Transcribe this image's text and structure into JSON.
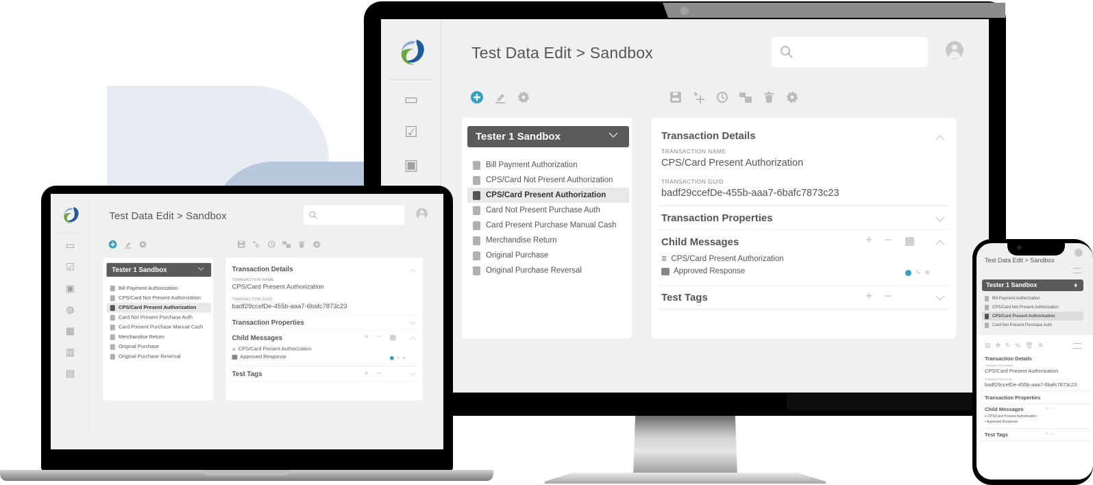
{
  "app": {
    "title": "Test Data Edit > Sandbox",
    "search": {
      "placeholder": ""
    },
    "accent_color": "#34a0c4",
    "sidebar": {
      "icons": [
        "windows-icon",
        "checklist-card-icon",
        "card-check-icon",
        "globe-sync-icon",
        "calendar-search-icon",
        "report-touch-icon",
        "document-search-icon"
      ]
    },
    "left_toolbar": [
      "add-icon",
      "edit-icon",
      "gear-icon"
    ],
    "right_toolbar": [
      "save-icon",
      "move-icon",
      "history-icon",
      "transfer-icon",
      "trash-icon",
      "gear-icon"
    ],
    "sandbox": {
      "selected": "Tester 1 Sandbox",
      "transactions": [
        {
          "label": "Bill Payment Authorization",
          "selected": false
        },
        {
          "label": "CPS/Card Not Present Authorization",
          "selected": false
        },
        {
          "label": "CPS/Card Present Authorization",
          "selected": true
        },
        {
          "label": "Card Not Present Purchase Auth",
          "selected": false
        },
        {
          "label": "Card Present Purchase Manual Cash",
          "selected": false
        },
        {
          "label": "Merchandise Return",
          "selected": false
        },
        {
          "label": "Original Purchase",
          "selected": false
        },
        {
          "label": "Original Purchase Reversal",
          "selected": false
        }
      ]
    },
    "details": {
      "section_title": "Transaction Details",
      "name_label": "TRANSACTION NAME",
      "name_value": "CPS/Card Present Authorization",
      "guid_label": "TRANSACTION GUID",
      "guid_value": "badf29ccefDe-455b-aaa7-6bafc7873c23",
      "properties_title": "Transaction Properties",
      "child_title": "Child Messages",
      "child_items": [
        "CPS/Card Present Authorization",
        "Approved Response"
      ],
      "tags_title": "Test Tags",
      "plus": "+",
      "minus": "−"
    }
  }
}
